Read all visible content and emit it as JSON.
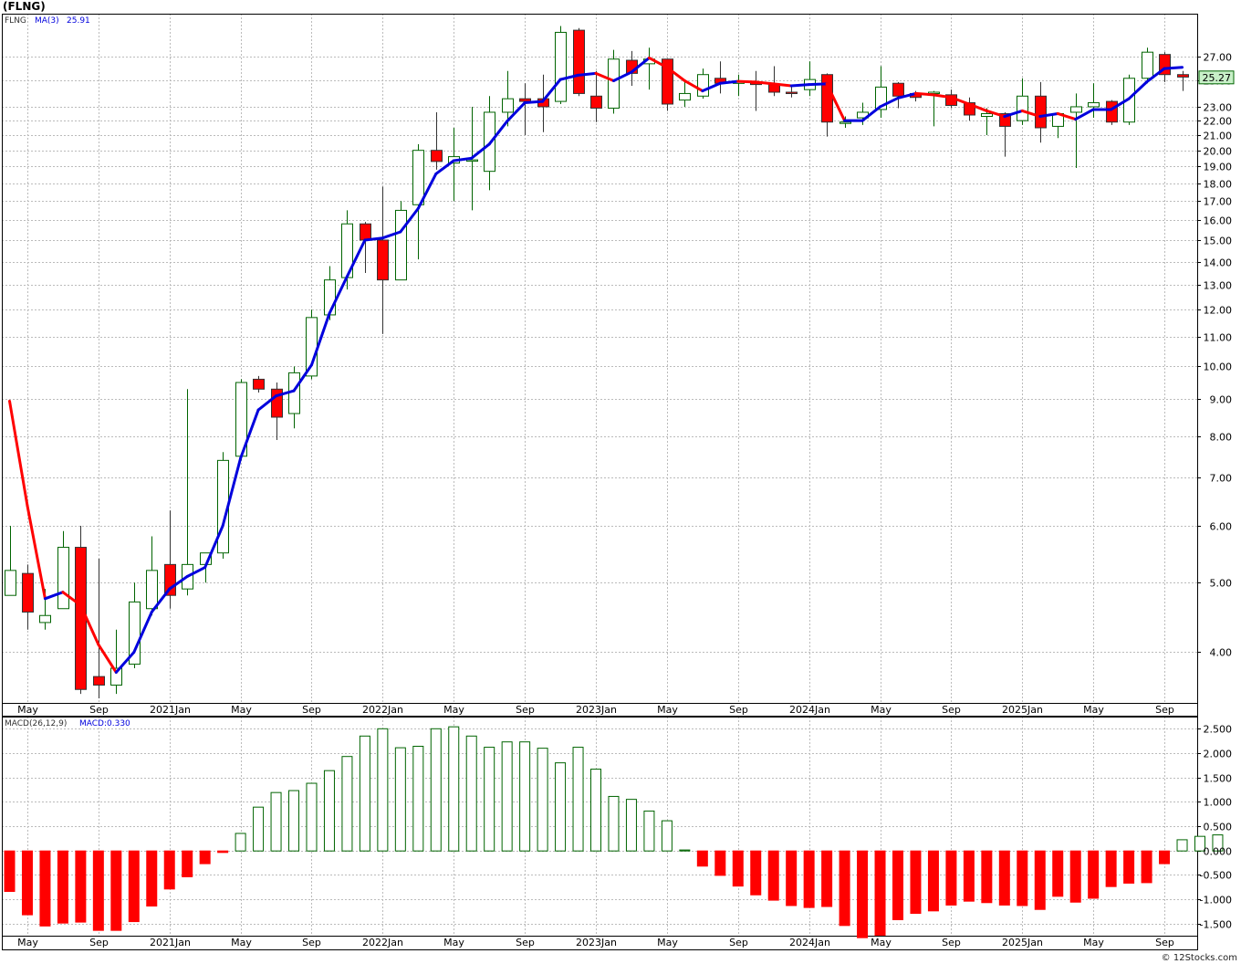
{
  "title": "(FLNG)",
  "credit": "© 12Stocks.com",
  "colors": {
    "up": "#006400",
    "down": "#ff0000",
    "ma_up": "#0000dd",
    "ma_down": "#ff0000",
    "grid": "#bbbbbb",
    "last_price_bg": "#c8f0c8"
  },
  "chart_data": [
    {
      "type": "candlestick",
      "panel_label": "FLNG",
      "ma_label": "MA(3)",
      "ma_value": "25.91",
      "last_price_label": "25.27",
      "y_scale": "log",
      "ylim": [
        3.4,
        31
      ],
      "y_ticks": [
        4,
        5,
        6,
        7,
        8,
        9,
        10,
        11,
        12,
        13,
        14,
        15,
        16,
        17,
        18,
        19,
        20,
        21,
        22,
        23,
        25,
        27
      ],
      "y_tick_labels": [
        "4.00",
        "5.00",
        "6.00",
        "7.00",
        "8.00",
        "9.00",
        "10.00",
        "11.00",
        "12.00",
        "13.00",
        "14.00",
        "15.00",
        "16.00",
        "17.00",
        "18.00",
        "19.00",
        "20.00",
        "21.00",
        "22.00",
        "23.00",
        "25.00",
        "27.00"
      ],
      "x_labels": [
        {
          "index": 1,
          "label": "May"
        },
        {
          "index": 5,
          "label": "Sep"
        },
        {
          "index": 9,
          "label": "2021Jan"
        },
        {
          "index": 13,
          "label": "May"
        },
        {
          "index": 17,
          "label": "Sep"
        },
        {
          "index": 21,
          "label": "2022Jan"
        },
        {
          "index": 25,
          "label": "May"
        },
        {
          "index": 29,
          "label": "Sep"
        },
        {
          "index": 33,
          "label": "2023Jan"
        },
        {
          "index": 37,
          "label": "May"
        },
        {
          "index": 41,
          "label": "Sep"
        },
        {
          "index": 45,
          "label": "2024Jan"
        },
        {
          "index": 49,
          "label": "May"
        },
        {
          "index": 53,
          "label": "Sep"
        },
        {
          "index": 57,
          "label": "2025Jan"
        },
        {
          "index": 61,
          "label": "May"
        },
        {
          "index": 65,
          "label": "Sep"
        }
      ],
      "ohlc": [
        [
          4.8,
          6.0,
          4.8,
          5.2
        ],
        [
          5.15,
          5.3,
          4.3,
          4.55
        ],
        [
          4.4,
          4.9,
          4.3,
          4.5
        ],
        [
          4.6,
          5.9,
          4.6,
          5.6
        ],
        [
          5.6,
          6.0,
          3.5,
          3.55
        ],
        [
          3.7,
          5.4,
          3.45,
          3.6
        ],
        [
          3.6,
          4.3,
          3.5,
          3.8
        ],
        [
          3.85,
          5.0,
          3.8,
          4.7
        ],
        [
          4.6,
          5.8,
          4.5,
          5.2
        ],
        [
          5.3,
          6.3,
          4.6,
          4.8
        ],
        [
          4.9,
          9.3,
          4.8,
          5.3
        ],
        [
          5.3,
          5.5,
          5.0,
          5.5
        ],
        [
          5.5,
          7.6,
          5.4,
          7.4
        ],
        [
          7.5,
          9.6,
          7.4,
          9.5
        ],
        [
          9.6,
          9.7,
          9.2,
          9.3
        ],
        [
          9.3,
          9.5,
          7.9,
          8.5
        ],
        [
          8.6,
          10.0,
          8.2,
          9.8
        ],
        [
          9.7,
          12.0,
          9.6,
          11.7
        ],
        [
          11.8,
          13.8,
          11.6,
          13.2
        ],
        [
          13.3,
          16.5,
          12.8,
          15.8
        ],
        [
          15.8,
          15.9,
          13.5,
          15.0
        ],
        [
          15.0,
          17.8,
          11.1,
          13.2
        ],
        [
          13.2,
          17.0,
          13.2,
          16.5
        ],
        [
          16.8,
          20.4,
          14.1,
          20.0
        ],
        [
          20.0,
          22.6,
          18.8,
          19.3
        ],
        [
          19.2,
          21.5,
          17.0,
          19.6
        ],
        [
          19.4,
          23.0,
          16.5,
          19.4
        ],
        [
          18.7,
          23.8,
          17.6,
          22.6
        ],
        [
          22.6,
          25.8,
          21.6,
          23.6
        ],
        [
          23.6,
          24.8,
          21.0,
          23.4
        ],
        [
          23.6,
          25.5,
          21.2,
          23.0
        ],
        [
          23.4,
          29.8,
          23.2,
          29.2
        ],
        [
          29.4,
          29.6,
          23.8,
          24.0
        ],
        [
          23.8,
          25.8,
          21.9,
          22.9
        ],
        [
          22.9,
          27.6,
          22.5,
          26.8
        ],
        [
          26.7,
          27.5,
          24.6,
          25.6
        ],
        [
          26.4,
          27.8,
          24.3,
          26.8
        ],
        [
          26.8,
          26.8,
          22.7,
          23.2
        ],
        [
          23.5,
          25.0,
          23.0,
          24.0
        ],
        [
          23.8,
          26.0,
          23.6,
          25.5
        ],
        [
          25.2,
          26.6,
          24.0,
          24.8
        ],
        [
          24.9,
          25.5,
          23.8,
          24.9
        ],
        [
          24.9,
          25.8,
          22.7,
          24.7
        ],
        [
          24.7,
          26.2,
          23.8,
          24.1
        ],
        [
          24.1,
          24.6,
          23.7,
          24.0
        ],
        [
          24.3,
          26.6,
          23.8,
          25.1
        ],
        [
          25.5,
          25.6,
          20.9,
          21.9
        ],
        [
          21.9,
          22.3,
          21.5,
          21.9
        ],
        [
          22.2,
          23.3,
          21.7,
          22.6
        ],
        [
          22.8,
          26.2,
          22.2,
          24.5
        ],
        [
          24.8,
          24.9,
          22.9,
          23.8
        ],
        [
          24.0,
          24.2,
          23.4,
          23.7
        ],
        [
          24.0,
          24.2,
          21.6,
          24.1
        ],
        [
          23.9,
          24.3,
          22.9,
          23.1
        ],
        [
          23.3,
          23.7,
          22.0,
          22.4
        ],
        [
          22.3,
          22.9,
          21.0,
          22.5
        ],
        [
          22.5,
          22.6,
          19.6,
          21.6
        ],
        [
          22.0,
          25.2,
          21.7,
          23.8
        ],
        [
          23.8,
          24.9,
          20.5,
          21.5
        ],
        [
          21.6,
          22.6,
          20.8,
          22.5
        ],
        [
          22.6,
          24.0,
          18.9,
          23.0
        ],
        [
          23.0,
          24.8,
          22.2,
          23.3
        ],
        [
          23.4,
          23.5,
          21.7,
          21.9
        ],
        [
          21.9,
          25.5,
          21.7,
          25.2
        ],
        [
          25.2,
          27.8,
          24.8,
          27.4
        ],
        [
          27.2,
          27.4,
          24.9,
          25.5
        ],
        [
          25.5,
          25.8,
          24.2,
          25.3
        ]
      ],
      "ma3": [
        8.95,
        6.4,
        4.75,
        4.85,
        4.65,
        4.1,
        3.75,
        4.0,
        4.55,
        4.9,
        5.1,
        5.25,
        6.0,
        7.45,
        8.7,
        9.1,
        9.25,
        10.05,
        11.85,
        13.35,
        15.0,
        15.1,
        15.4,
        16.6,
        18.55,
        19.35,
        19.5,
        20.4,
        21.95,
        23.3,
        23.4,
        25.1,
        25.45,
        25.6,
        25.0,
        25.7,
        26.9,
        26.1,
        25.0,
        24.2,
        24.8,
        24.95,
        24.9,
        24.75,
        24.6,
        24.7,
        24.75,
        22.0,
        22.0,
        23.0,
        23.65,
        24.0,
        23.9,
        23.7,
        23.2,
        22.7,
        22.3,
        22.7,
        22.3,
        22.5,
        22.1,
        22.8,
        22.8,
        23.6,
        24.9,
        26.0,
        26.1
      ],
      "macd_label": "MACD(26,12,9)",
      "macd_value_label": "MACD:0.330",
      "macd_ylim": [
        -1.75,
        2.75
      ],
      "macd_ticks": [
        2.5,
        2.0,
        1.5,
        1.0,
        0.5,
        0.0,
        -0.5,
        -1.0,
        -1.5
      ],
      "macd_tick_labels": [
        "2.500",
        "2.000",
        "1.500",
        "1.000",
        "0.500",
        "0.000",
        "-0.500",
        "-1.000",
        "-1.500"
      ],
      "macd": [
        -0.85,
        -1.33,
        -1.56,
        -1.5,
        -1.48,
        -1.65,
        -1.65,
        -1.47,
        -1.15,
        -0.8,
        -0.55,
        -0.28,
        -0.05,
        0.36,
        0.9,
        1.2,
        1.24,
        1.39,
        1.65,
        1.94,
        2.36,
        2.51,
        2.12,
        2.15,
        2.51,
        2.55,
        2.36,
        2.13,
        2.24,
        2.24,
        2.11,
        1.81,
        2.13,
        1.68,
        1.12,
        1.06,
        0.82,
        0.62,
        0.02,
        -0.33,
        -0.52,
        -0.74,
        -0.92,
        -1.03,
        -1.14,
        -1.18,
        -1.16,
        -1.55,
        -1.8,
        -1.75,
        -1.43,
        -1.3,
        -1.25,
        -1.13,
        -1.05,
        -1.08,
        -1.13,
        -1.14,
        -1.22,
        -0.95,
        -1.07,
        -0.99,
        -0.75,
        -0.68,
        -0.67,
        -0.28,
        0.23,
        0.3,
        0.33
      ]
    }
  ]
}
